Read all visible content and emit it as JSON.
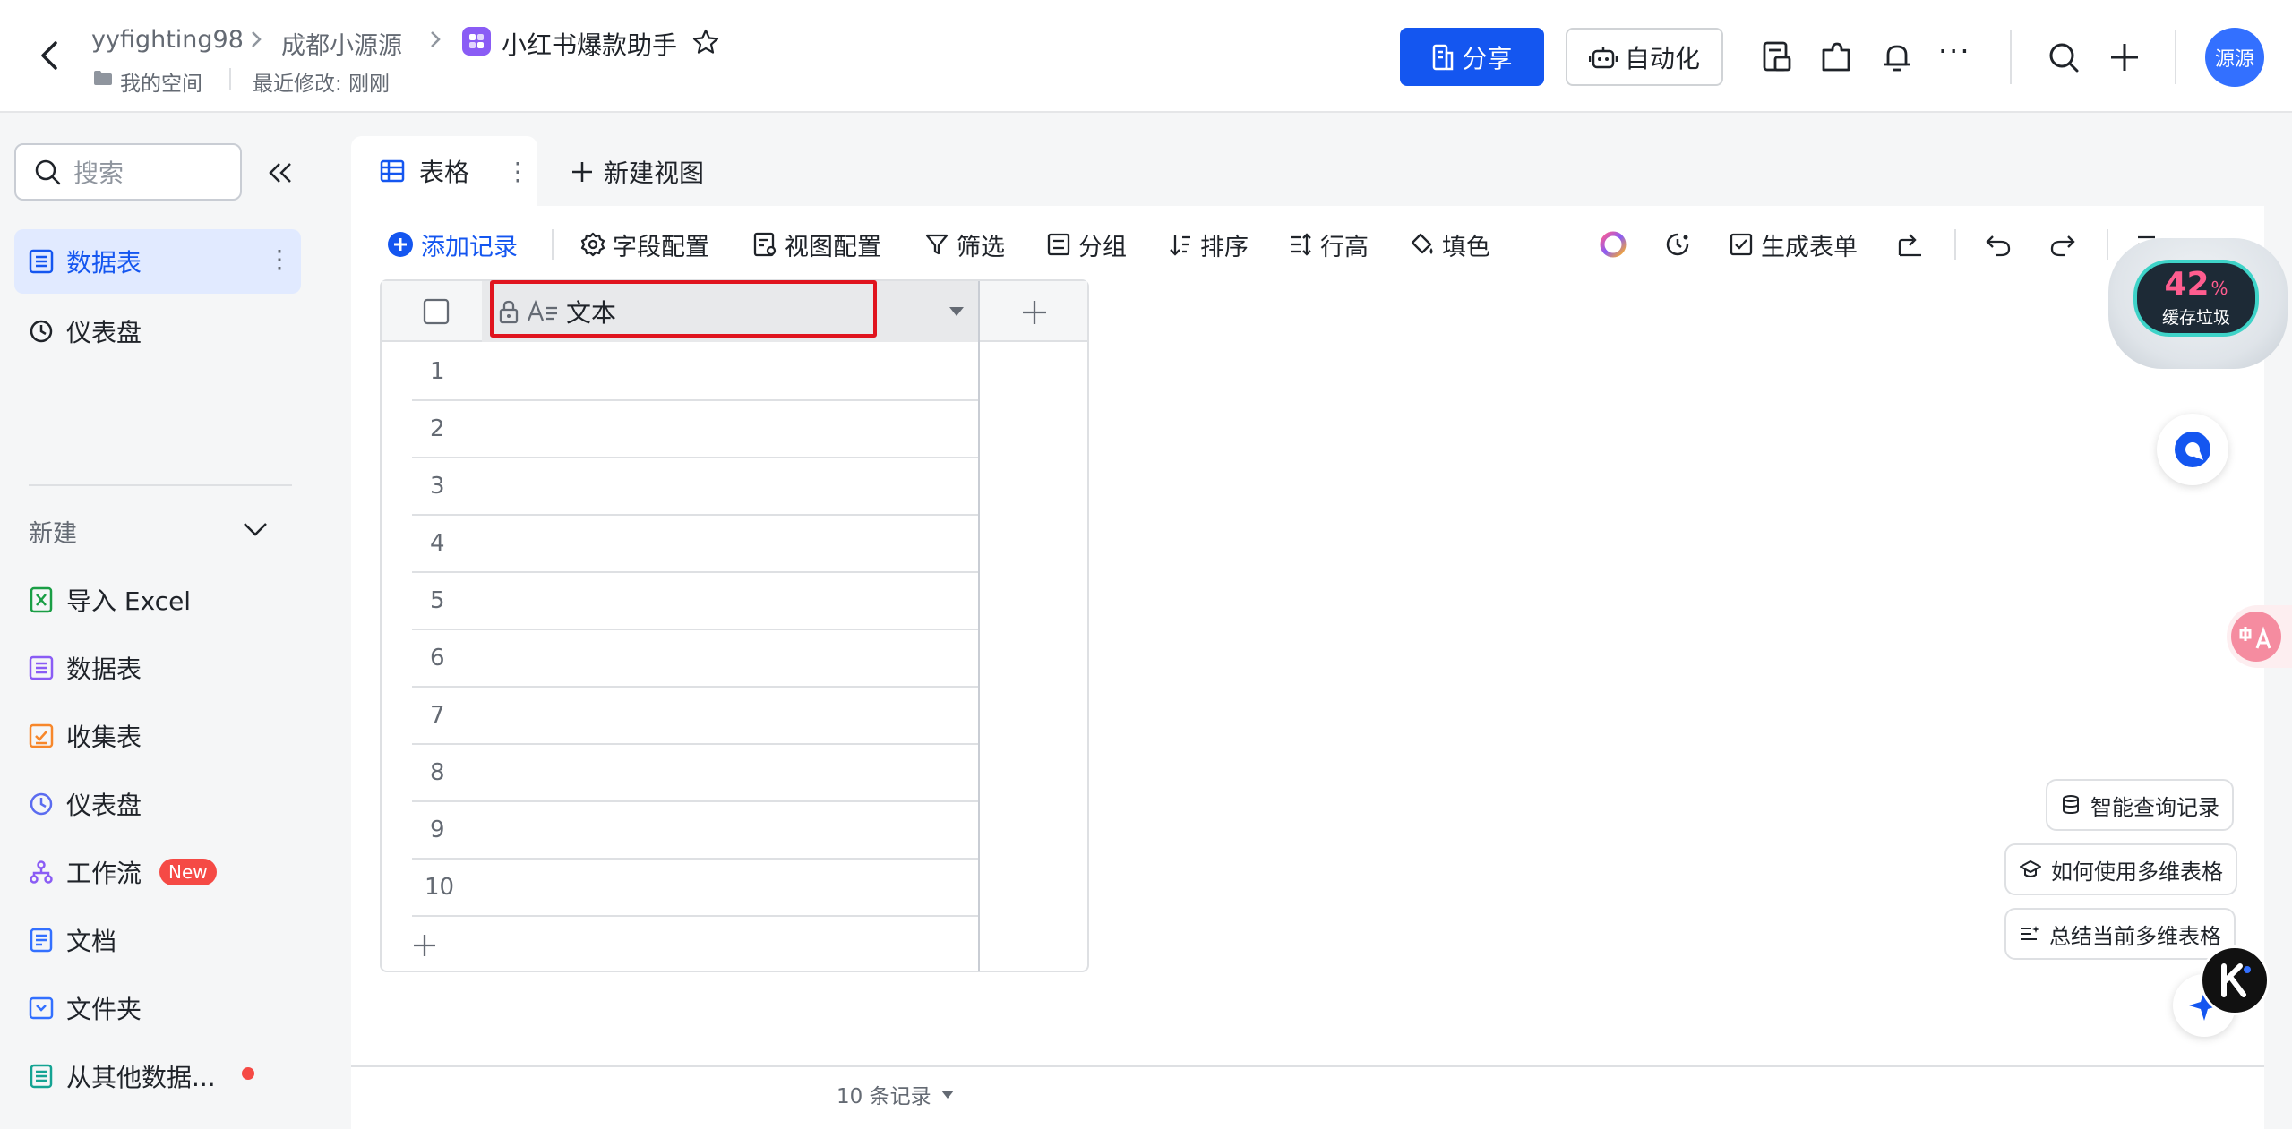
{
  "header": {
    "breadcrumb": [
      "yyfighting98",
      "成都小源源"
    ],
    "doc_title": "小红书爆款助手",
    "space": "我的空间",
    "last_modified": "最近修改: 刚刚",
    "share_label": "分享",
    "automation_label": "自动化",
    "avatar_text": "源源",
    "more_label": "···"
  },
  "sidebar": {
    "search_placeholder": "搜索",
    "items": [
      {
        "label": "数据表",
        "active": true
      },
      {
        "label": "仪表盘",
        "active": false
      }
    ],
    "new_section": "新建",
    "new_items": [
      {
        "label": "导入 Excel",
        "icon": "excel-icon"
      },
      {
        "label": "数据表",
        "icon": "table-icon"
      },
      {
        "label": "收集表",
        "icon": "form-icon"
      },
      {
        "label": "仪表盘",
        "icon": "dashboard-icon"
      },
      {
        "label": "工作流",
        "icon": "workflow-icon",
        "badge": "New"
      },
      {
        "label": "文档",
        "icon": "doc-icon"
      },
      {
        "label": "文件夹",
        "icon": "folder-icon"
      },
      {
        "label": "从其他数据...",
        "icon": "datasource-icon",
        "dot": true
      }
    ]
  },
  "view_tabs": {
    "active": "表格",
    "new_view": "新建视图"
  },
  "toolbar": {
    "add_record": "添加记录",
    "field_config": "字段配置",
    "view_config": "视图配置",
    "filter": "筛选",
    "group": "分组",
    "sort": "排序",
    "row_height": "行高",
    "fill_color": "填色",
    "gen_form": "生成表单"
  },
  "grid": {
    "field_name": "文本",
    "rows": [
      "1",
      "2",
      "3",
      "4",
      "5",
      "6",
      "7",
      "8",
      "9",
      "10"
    ],
    "record_count": "10 条记录"
  },
  "float": {
    "robot_percent": "42",
    "robot_percent_unit": "%",
    "robot_label": "缓存垃圾",
    "ai_pills": [
      "智能查询记录",
      "如何使用多维表格",
      "总结当前多维表格"
    ]
  },
  "colors": {
    "accent": "#1456f0",
    "highlight_box": "#e0141e",
    "badge_red": "#f54a45"
  }
}
